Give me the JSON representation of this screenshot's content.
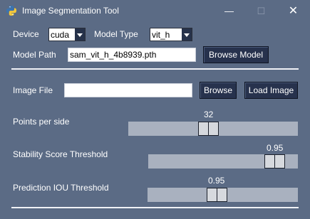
{
  "window": {
    "title": "Image Segmentation Tool",
    "minimize_glyph": "—",
    "maximize_glyph": "☐",
    "close_glyph": "✕",
    "app_icon": "python-icon"
  },
  "model": {
    "device_label": "Device",
    "device_value": "cuda",
    "model_type_label": "Model Type",
    "model_type_value": "vit_h",
    "model_path_label": "Model Path",
    "model_path_value": "sam_vit_h_4b8939.pth",
    "browse_model_label": "Browse Model"
  },
  "image": {
    "image_file_label": "Image File",
    "image_file_value": "",
    "browse_label": "Browse",
    "load_image_label": "Load Image"
  },
  "sliders": {
    "points_label": "Points per side",
    "points_value": "32",
    "stability_label": "Stability Score Threshold",
    "stability_value": "0.95",
    "iou_label": "Prediction IOU Threshold",
    "iou_value": "0.95"
  },
  "colors": {
    "background": "#5b6b85",
    "button": "#27324d",
    "track": "#a9b1bf"
  }
}
